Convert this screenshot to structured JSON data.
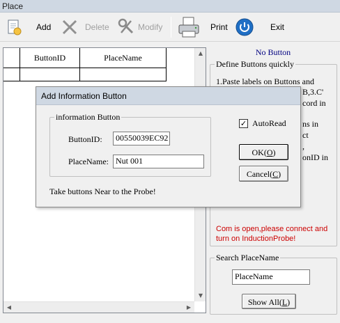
{
  "window": {
    "title": "Place"
  },
  "toolbar": {
    "add_label": "Add",
    "delete_label": "Delete",
    "modify_label": "Modify",
    "print_label": "Print",
    "exit_label": "Exit"
  },
  "grid": {
    "columns": [
      "ButtonID",
      "PlaceName"
    ],
    "rows": [
      [
        "",
        ""
      ]
    ]
  },
  "right_panel": {
    "title": "No Button",
    "define_group": {
      "legend": "Define Buttons quickly",
      "visible_lines": [
        "1.Paste labels on Buttons and",
        "B,3.C'",
        "cord in",
        "ns in",
        "ct",
        ",",
        "onID in"
      ]
    },
    "status": "Com is open,please connect and turn on InductionProbe!",
    "search_group": {
      "legend": "Search PlaceName",
      "input_value": "PlaceName",
      "show_all_label": "Show All(",
      "show_all_hotkey": "L",
      "show_all_suffix": ")"
    }
  },
  "dialog": {
    "title": "Add Information Button",
    "group_legend": "information Button",
    "buttonid_label": "ButtonID:",
    "buttonid_value": "00550039EC92",
    "placename_label": "PlaceName:",
    "placename_value": "Nut 001",
    "autoread_label": "AutoRead",
    "autoread_checked": true,
    "ok_prefix": "OK(",
    "ok_hotkey": "O",
    "ok_suffix": ")",
    "cancel_prefix": "Cancel(",
    "cancel_hotkey": "C",
    "cancel_suffix": ")",
    "hint": "Take buttons Near to the Probe!"
  },
  "colors": {
    "status_text": "#cc0000",
    "panel_title": "#000080",
    "exit_icon": "#1f6fc5"
  }
}
